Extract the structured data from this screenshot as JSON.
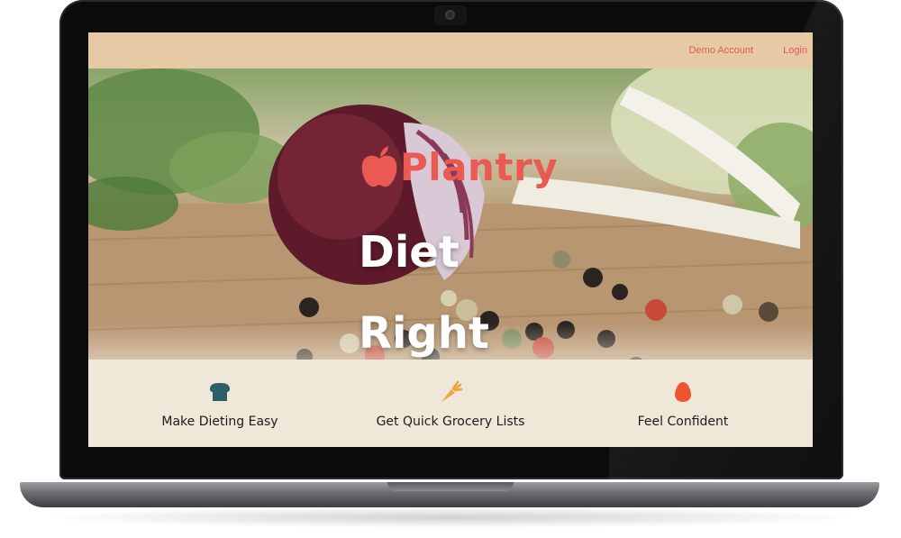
{
  "nav": {
    "links": [
      "Demo Account",
      "Login"
    ]
  },
  "hero": {
    "brand_name": "Plantry",
    "lines": [
      "Diet",
      "Right"
    ]
  },
  "features": [
    {
      "label": "Make Dieting Easy",
      "icon": "bread-icon"
    },
    {
      "label": "Get Quick Grocery Lists",
      "icon": "carrot-icon"
    },
    {
      "label": "Feel Confident",
      "icon": "egg-icon"
    }
  ],
  "colors": {
    "navbar": "#e6caa6",
    "accent": "#ea5a52",
    "feature_bg": "#efe7d8",
    "bread_icon": "#2e5e6a",
    "carrot_icon": "#f0a43a",
    "egg_icon": "#f0532f"
  }
}
